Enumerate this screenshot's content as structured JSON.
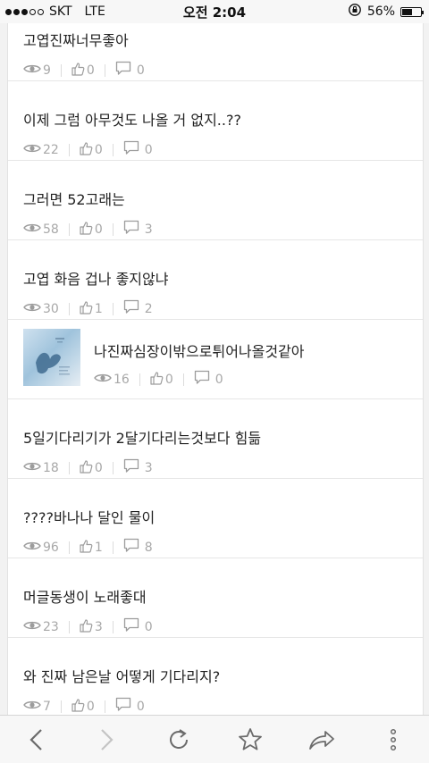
{
  "status_bar": {
    "carrier": "SKT",
    "network": "LTE",
    "time": "오전 2:04",
    "battery_percent": "56%",
    "battery_level": 0.56,
    "signal_bars": 3,
    "signal_total": 5
  },
  "posts": [
    {
      "title": "고엽진짜너무좋아",
      "views": "9",
      "likes": "0",
      "comments": "0"
    },
    {
      "title": "이제 그럼 아무것도 나올 거 없지..??",
      "views": "22",
      "likes": "0",
      "comments": "0"
    },
    {
      "title": "그러면 52고래는",
      "views": "58",
      "likes": "0",
      "comments": "3"
    },
    {
      "title": "고엽 화음 겁나 좋지않냐",
      "views": "30",
      "likes": "1",
      "comments": "2"
    },
    {
      "title": "나진짜심장이밖으로튀어나올것같아",
      "views": "16",
      "likes": "0",
      "comments": "0",
      "thumbnail": true
    },
    {
      "title": "5일기다리기가 2달기다리는것보다 힘듦",
      "views": "18",
      "likes": "0",
      "comments": "3"
    },
    {
      "title": "????바나나 달인 물이",
      "views": "96",
      "likes": "1",
      "comments": "8"
    },
    {
      "title": "머글동생이 노래좋대",
      "views": "23",
      "likes": "3",
      "comments": "0"
    },
    {
      "title": "와 진짜 남은날 어떻게 기다리지?",
      "views": "7",
      "likes": "0",
      "comments": "0"
    }
  ],
  "icons": {
    "views": "eye-icon",
    "likes": "thumbs-up-icon",
    "comments": "comment-icon"
  },
  "toolbar": [
    "back-icon",
    "forward-icon",
    "reload-icon",
    "bookmark-star-icon",
    "share-icon",
    "more-icon"
  ],
  "colors": {
    "meta_text": "#a8a8a8",
    "title_text": "#222222",
    "divider": "#e6e6e6",
    "toolbar_icon": "#6b6b6b",
    "toolbar_icon_disabled": "#c4c4c4"
  }
}
